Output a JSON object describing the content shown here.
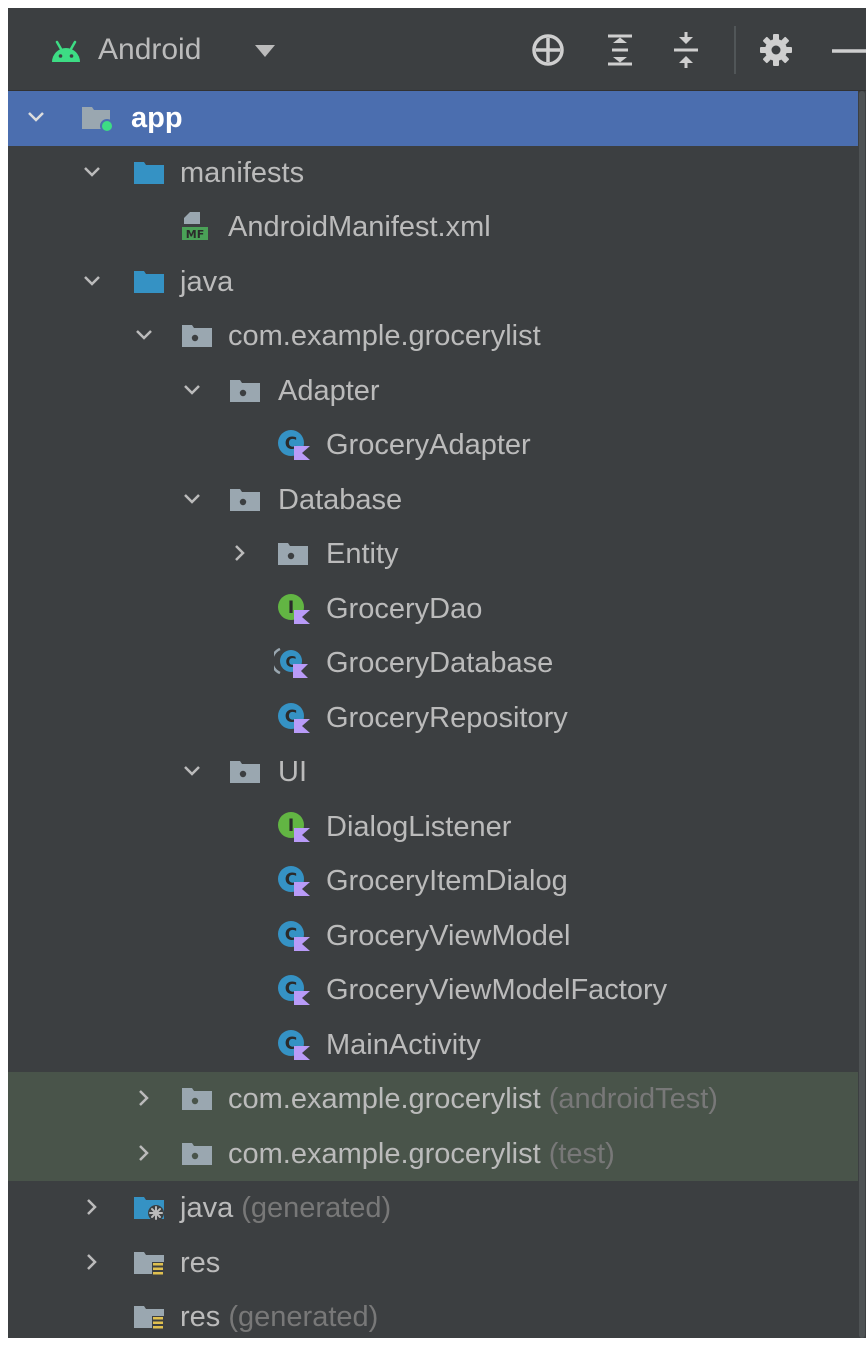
{
  "toolbar": {
    "title": "Android",
    "icons": [
      "android-icon",
      "dropdown-caret-icon",
      "locate-icon",
      "expand-all-icon",
      "collapse-all-icon",
      "gear-icon",
      "hide-icon"
    ]
  },
  "colors": {
    "panel_bg": "#3c3f41",
    "selected_bg": "#4b6eaf",
    "test_bg": "#49544a",
    "text": "#bbbbbb",
    "muted": "#787878",
    "android_green": "#3ddc84",
    "class_blue": "#3592c4",
    "interface_green": "#62b543",
    "kotlin_purple": "#b99bf8"
  },
  "tree": {
    "rows": [
      {
        "label": "app",
        "suffix": ""
      },
      {
        "label": "manifests",
        "suffix": ""
      },
      {
        "label": "AndroidManifest.xml",
        "suffix": ""
      },
      {
        "label": "java",
        "suffix": ""
      },
      {
        "label": "com.example.grocerylist",
        "suffix": ""
      },
      {
        "label": "Adapter",
        "suffix": ""
      },
      {
        "label": "GroceryAdapter",
        "suffix": ""
      },
      {
        "label": "Database",
        "suffix": ""
      },
      {
        "label": "Entity",
        "suffix": ""
      },
      {
        "label": "GroceryDao",
        "suffix": ""
      },
      {
        "label": "GroceryDatabase",
        "suffix": ""
      },
      {
        "label": "GroceryRepository",
        "suffix": ""
      },
      {
        "label": "UI",
        "suffix": ""
      },
      {
        "label": "DialogListener",
        "suffix": ""
      },
      {
        "label": "GroceryItemDialog",
        "suffix": ""
      },
      {
        "label": "GroceryViewModel",
        "suffix": ""
      },
      {
        "label": "GroceryViewModelFactory",
        "suffix": ""
      },
      {
        "label": "MainActivity",
        "suffix": ""
      },
      {
        "label": "com.example.grocerylist",
        "suffix": "(androidTest)"
      },
      {
        "label": "com.example.grocerylist",
        "suffix": "(test)"
      },
      {
        "label": "java",
        "suffix": "(generated)"
      },
      {
        "label": "res",
        "suffix": ""
      },
      {
        "label": "res",
        "suffix": "(generated)"
      }
    ]
  }
}
